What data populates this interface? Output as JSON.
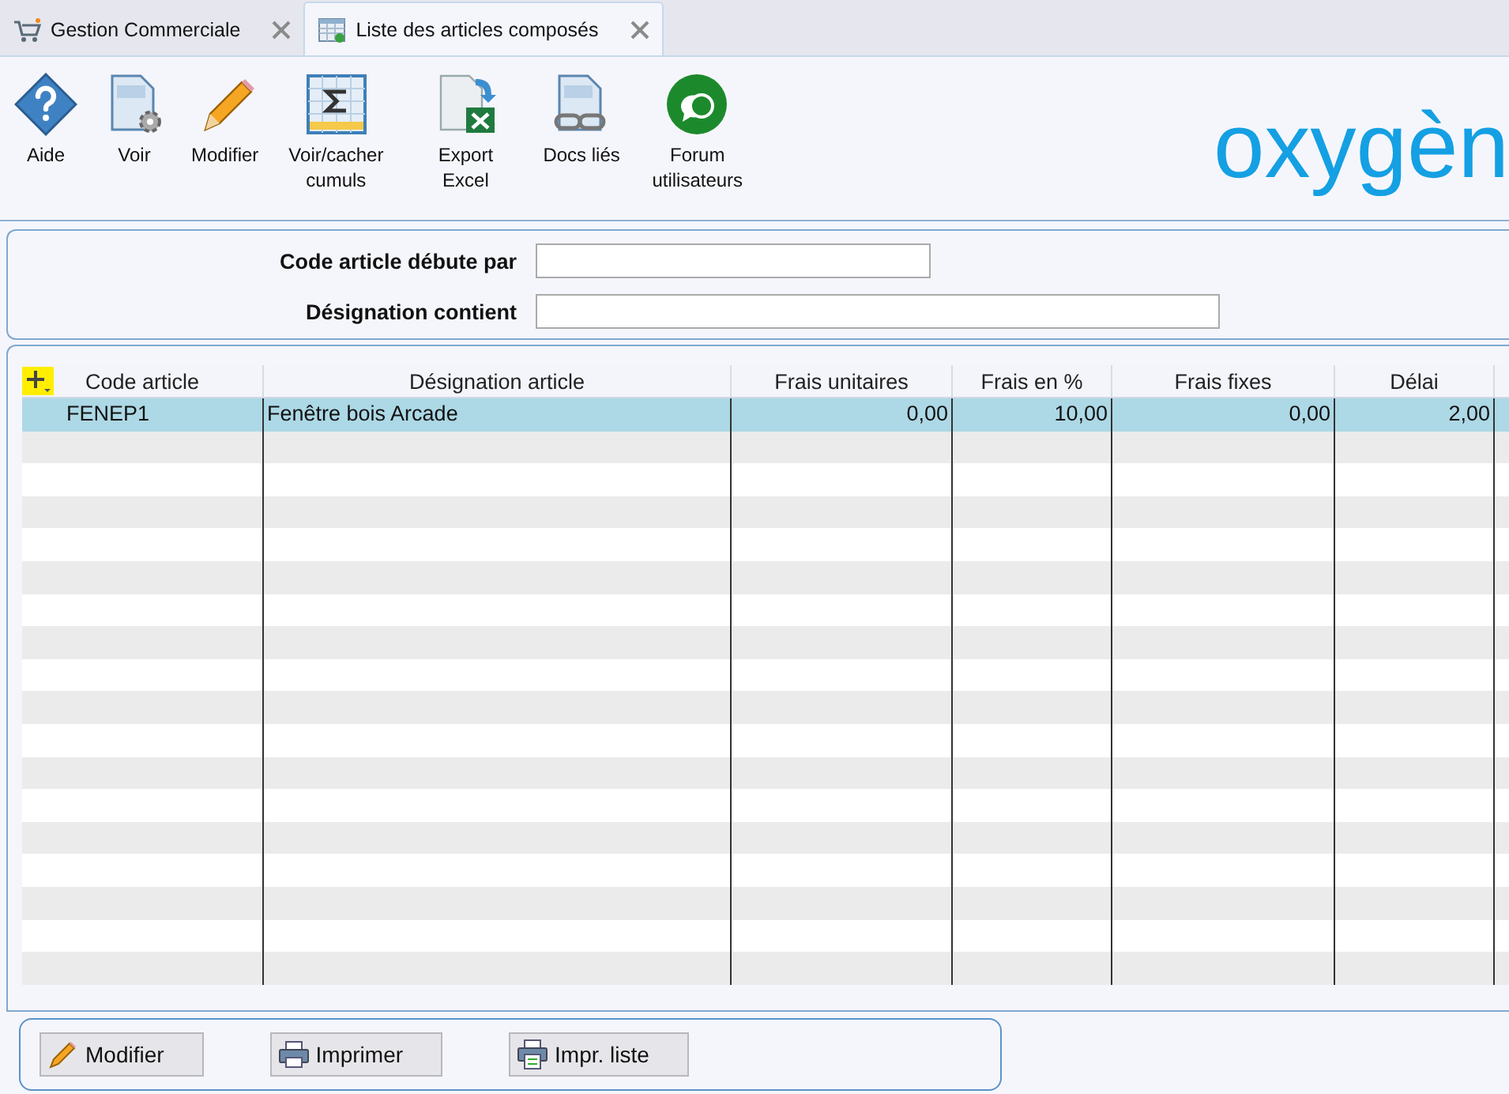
{
  "tabs": [
    {
      "label": "Gestion Commerciale",
      "selected": false
    },
    {
      "label": "Liste des articles composés",
      "selected": true
    }
  ],
  "toolbar": [
    {
      "kind": "help",
      "label": "Aide"
    },
    {
      "kind": "view",
      "label": "Voir"
    },
    {
      "kind": "edit",
      "label": "Modifier"
    },
    {
      "kind": "sum",
      "label": "Voir/cacher cumuls"
    },
    {
      "kind": "excel",
      "label": "Export Excel"
    },
    {
      "kind": "docs",
      "label": "Docs liés"
    },
    {
      "kind": "forum",
      "label": "Forum utilisateurs"
    }
  ],
  "logo": "oxygèn",
  "filters": [
    {
      "label": "Code article débute par"
    },
    {
      "label": "Désignation contient"
    }
  ],
  "table": {
    "columns": [
      "Code article",
      "Désignation article",
      "Frais unitaires",
      "Frais en %",
      "Frais fixes",
      "Délai"
    ],
    "rows": [
      {
        "selected": true,
        "cells": [
          "FENEP1",
          "Fenêtre bois Arcade",
          "0,00",
          "10,00",
          "0,00",
          "2,00"
        ]
      }
    ]
  },
  "buttons": [
    {
      "kind": "edit",
      "label": "Modifier"
    },
    {
      "kind": "print",
      "label": "Imprimer"
    },
    {
      "kind": "print-list",
      "label": "Impr. liste"
    }
  ]
}
